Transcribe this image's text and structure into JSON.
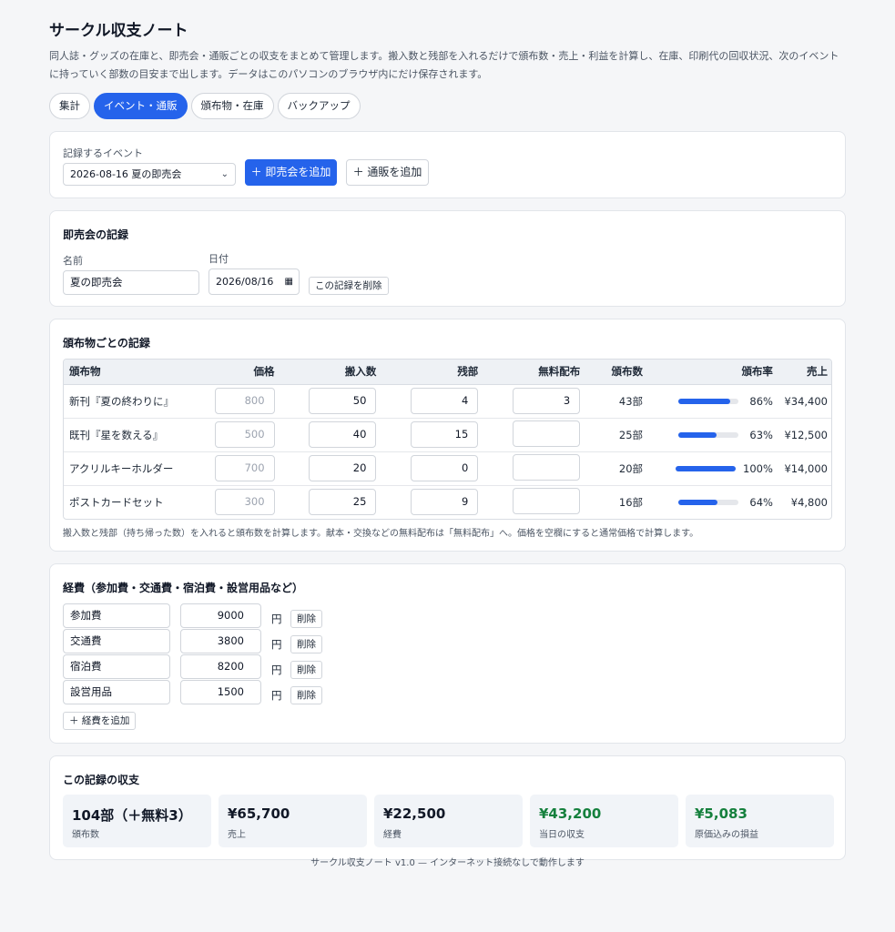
{
  "app": {
    "title": "サークル収支ノート",
    "description": "同人誌・グッズの在庫と、即売会・通販ごとの収支をまとめて管理します。搬入数と残部を入れるだけで頒布数・売上・利益を計算し、在庫、印刷代の回収状況、次のイベントに持っていく部数の目安まで出します。データはこのパソコンのブラウザ内にだけ保存されます。"
  },
  "tabs": [
    {
      "label": "集計",
      "active": false
    },
    {
      "label": "イベント・通販",
      "active": true
    },
    {
      "label": "頒布物・在庫",
      "active": false
    },
    {
      "label": "バックアップ",
      "active": false
    }
  ],
  "event_select": {
    "label": "記録するイベント",
    "value": "2026-08-16 夏の即売会",
    "add_event_label": "＋ 即売会を追加",
    "add_mail_label": "＋ 通販を追加"
  },
  "record": {
    "title": "即売会の記録",
    "name_label": "名前",
    "name_value": "夏の即売会",
    "date_label": "日付",
    "date_value": "2026/08/16",
    "delete_label": "この記録を削除"
  },
  "items": {
    "title": "頒布物ごとの記録",
    "headers": {
      "item": "頒布物",
      "price": "価格",
      "brought": "搬入数",
      "remaining": "残部",
      "free": "無料配布",
      "sold": "頒布数",
      "rate": "頒布率",
      "sales": "売上"
    },
    "rows": [
      {
        "name": "新刊『夏の終わりに』",
        "price": "800",
        "brought": "50",
        "remaining": "4",
        "free": "3",
        "sold": "43部",
        "rate": 86,
        "rate_label": "86%",
        "sales": "¥34,400"
      },
      {
        "name": "既刊『星を数える』",
        "price": "500",
        "brought": "40",
        "remaining": "15",
        "free": "",
        "sold": "25部",
        "rate": 63,
        "rate_label": "63%",
        "sales": "¥12,500"
      },
      {
        "name": "アクリルキーホルダー",
        "price": "700",
        "brought": "20",
        "remaining": "0",
        "free": "",
        "sold": "20部",
        "rate": 100,
        "rate_label": "100%",
        "sales": "¥14,000"
      },
      {
        "name": "ポストカードセット",
        "price": "300",
        "brought": "25",
        "remaining": "9",
        "free": "",
        "sold": "16部",
        "rate": 64,
        "rate_label": "64%",
        "sales": "¥4,800"
      }
    ],
    "note": "搬入数と残部（持ち帰った数）を入れると頒布数を計算します。献本・交換などの無料配布は「無料配布」へ。価格を空欄にすると通常価格で計算します。"
  },
  "expenses": {
    "title": "経費（参加費・交通費・宿泊費・設営用品など）",
    "rows": [
      {
        "name": "参加費",
        "amount": "9000"
      },
      {
        "name": "交通費",
        "amount": "3800"
      },
      {
        "name": "宿泊費",
        "amount": "8200"
      },
      {
        "name": "設営用品",
        "amount": "1500"
      }
    ],
    "unit": "円",
    "delete_label": "削除",
    "add_label": "＋ 経費を追加"
  },
  "summary": {
    "title": "この記録の収支",
    "boxes": [
      {
        "value": "104部（＋無料3）",
        "label": "頒布数",
        "green": false
      },
      {
        "value": "¥65,700",
        "label": "売上",
        "green": false
      },
      {
        "value": "¥22,500",
        "label": "経費",
        "green": false
      },
      {
        "value": "¥43,200",
        "label": "当日の収支",
        "green": true
      },
      {
        "value": "¥5,083",
        "label": "原価込みの損益",
        "green": true
      }
    ]
  },
  "footer": "サークル収支ノート v1.0 — インターネット接続なしで動作します",
  "colors": {
    "accent": "#2563eb",
    "positive": "#15803d"
  }
}
